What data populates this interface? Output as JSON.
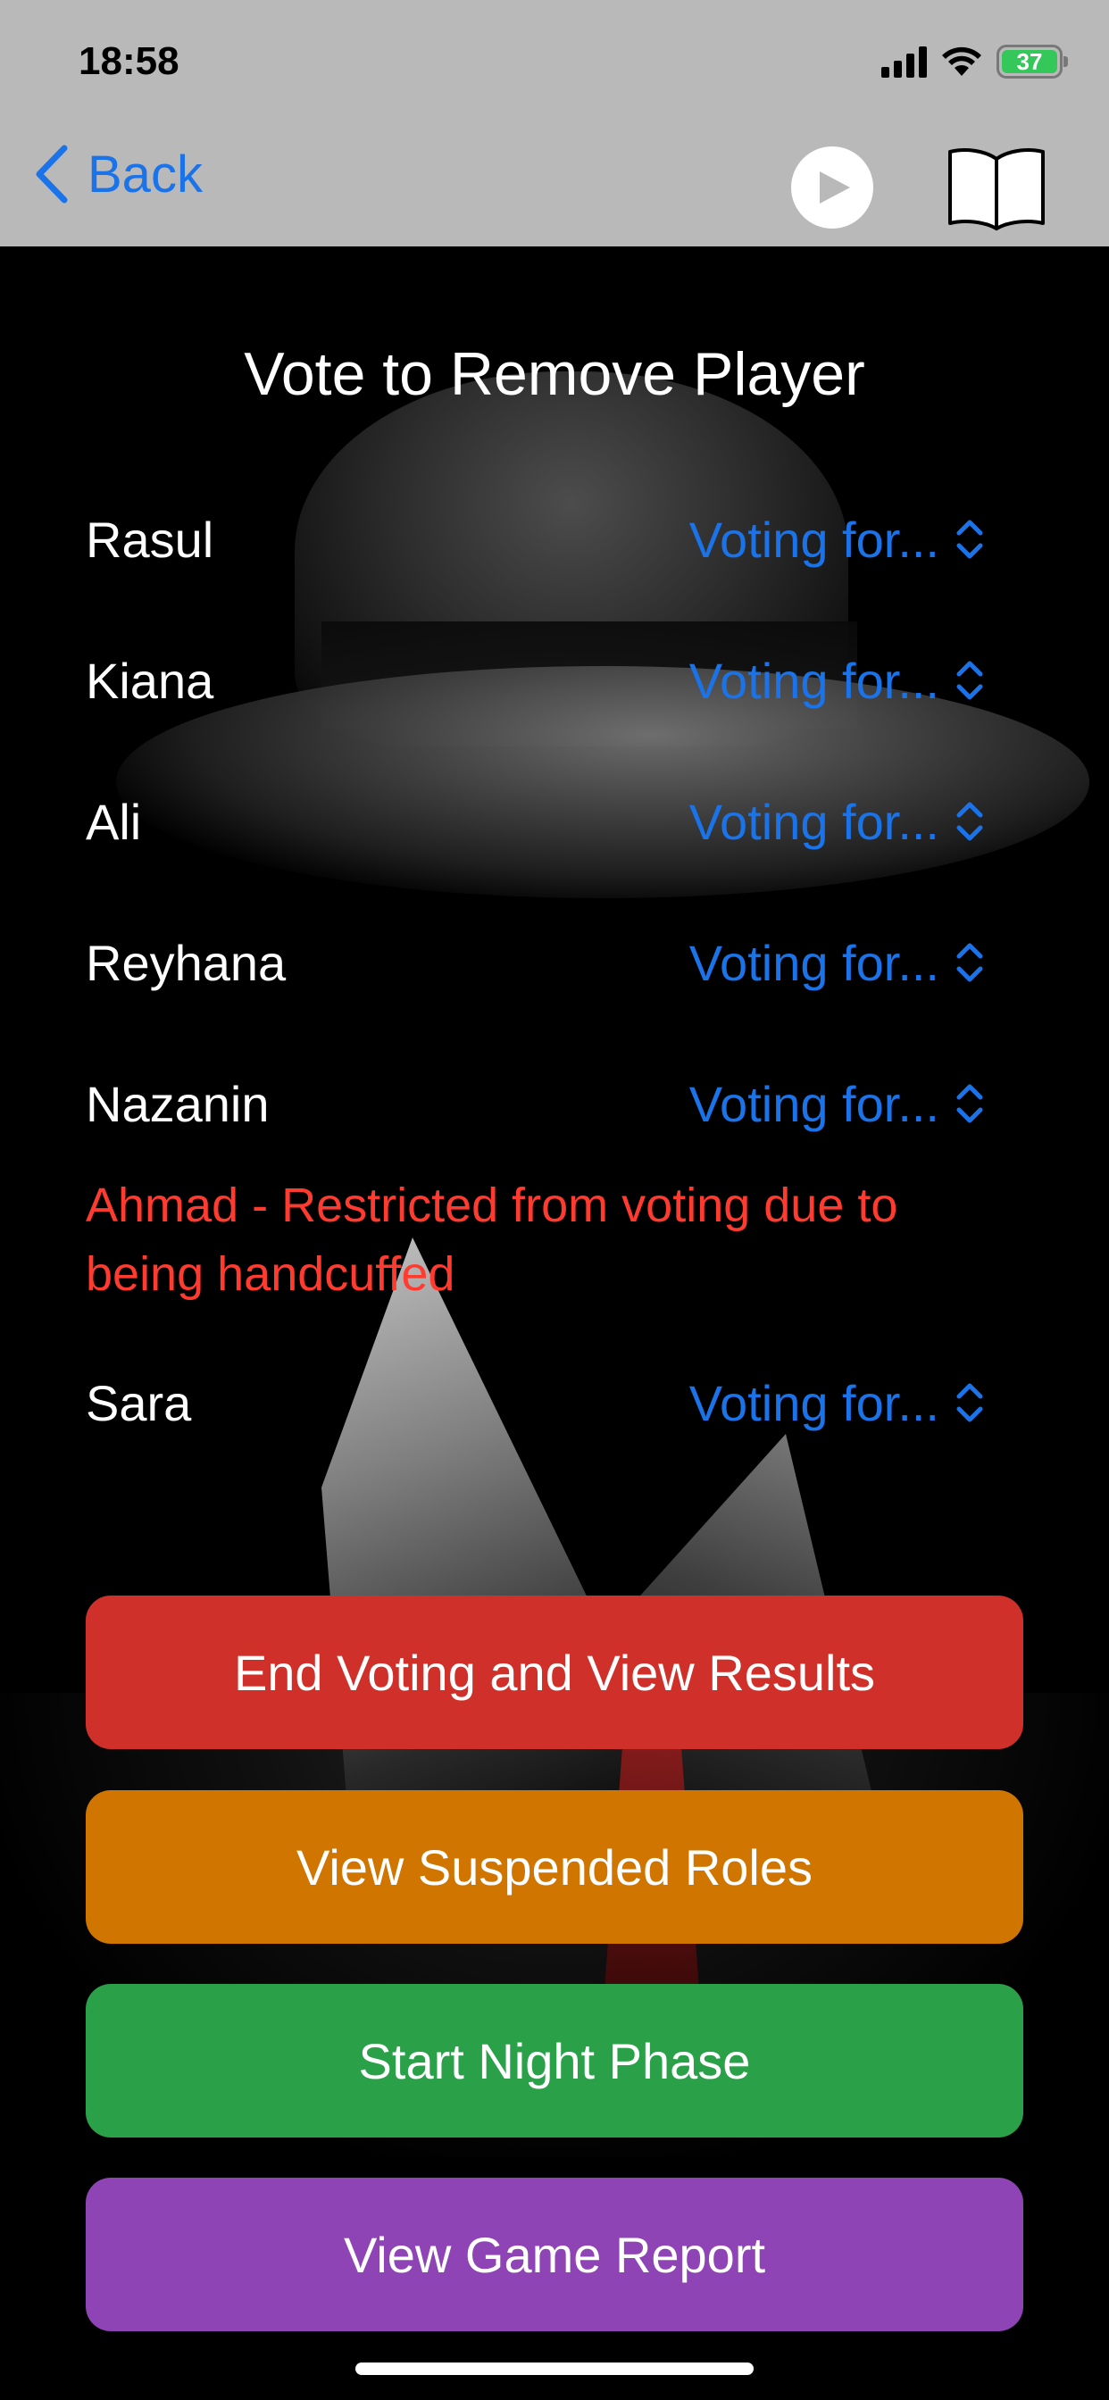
{
  "status_bar": {
    "time": "18:58",
    "battery": "37"
  },
  "nav": {
    "back_label": "Back",
    "icons": [
      "chevron-left-icon",
      "play-icon",
      "book-icon"
    ]
  },
  "main": {
    "title": "Vote to Remove Player",
    "voters": [
      {
        "name": "Rasul",
        "picker": "Voting for..."
      },
      {
        "name": "Kiana",
        "picker": "Voting for..."
      },
      {
        "name": "Ali",
        "picker": "Voting for..."
      },
      {
        "name": "Reyhana",
        "picker": "Voting for..."
      },
      {
        "name": "Nazanin",
        "picker": "Voting for..."
      },
      {
        "name": "Sara",
        "picker": "Voting for..."
      }
    ],
    "restricted_note": "Ahmad - Restricted from voting due to being handcuffed"
  },
  "actions": [
    {
      "label": "End Voting and View Results",
      "color": "#d0302a"
    },
    {
      "label": "View Suspended Roles",
      "color": "#cf7500"
    },
    {
      "label": "Start Night Phase",
      "color": "#2aa149"
    },
    {
      "label": "View Game Report",
      "color": "#8e44b4"
    }
  ],
  "colors": {
    "accent_blue": "#1a73e8",
    "warning_red": "#ff3b30",
    "battery_green": "#34c759"
  }
}
